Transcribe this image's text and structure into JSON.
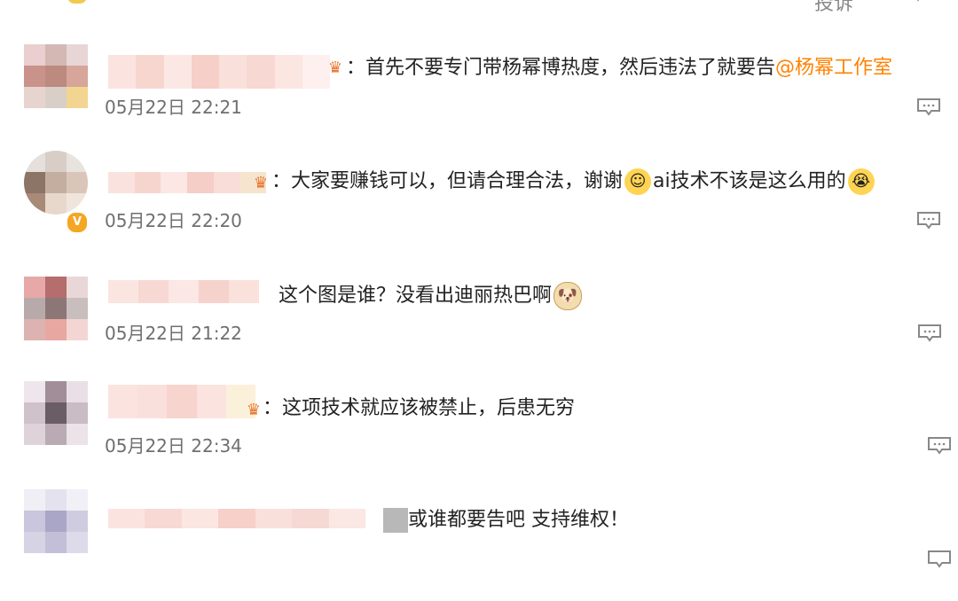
{
  "top_partial": {
    "action_label": "投诉"
  },
  "comments": [
    {
      "separator": "：",
      "text": "首先不要专门带杨幂博热度，然后违法了就要告",
      "mention": "@杨幂工作室",
      "timestamp": "05月22日 22:21"
    },
    {
      "separator": "：",
      "text_part1": "大家要赚钱可以，但请合理合法，谢谢",
      "text_part2": "ai技术不该是这么用的",
      "emoji_hug": "hug-emoji",
      "emoji_cry": "crying-emoji",
      "timestamp": "05月22日 22:20",
      "verified": true
    },
    {
      "text": "这个图是谁？没看出迪丽热巴啊",
      "emoji": "doge-emoji",
      "timestamp": "05月22日 21:22"
    },
    {
      "separator": "：",
      "text": "这项技术就应该被禁止，后患无穷",
      "timestamp": "05月22日 22:34"
    },
    {
      "text": "或谁都要告吧 支持维权！"
    }
  ],
  "colors": {
    "mention": "#ff8200",
    "timestamp": "#6f6f6f",
    "text": "#222222",
    "verified_badge": "#f5a623"
  }
}
